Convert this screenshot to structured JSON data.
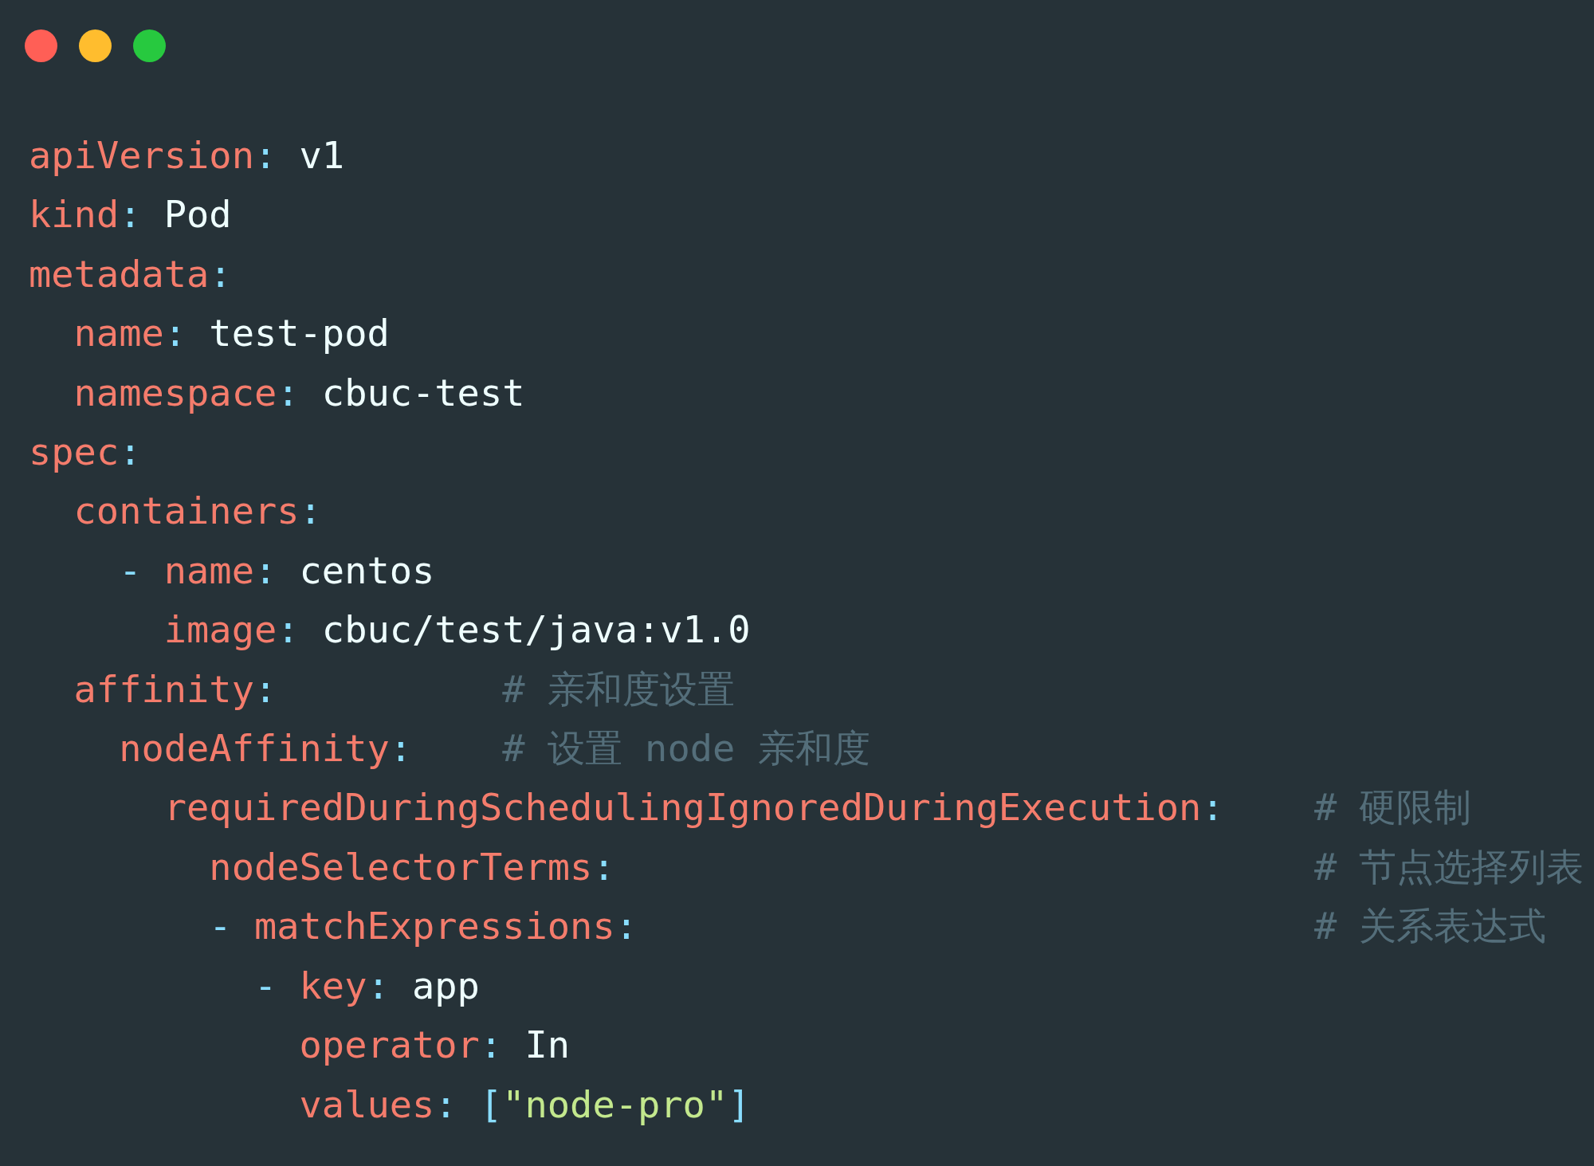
{
  "window": {
    "controls": [
      {
        "kind": "close"
      },
      {
        "kind": "minimize"
      },
      {
        "kind": "maximize"
      }
    ]
  },
  "code": [
    {
      "key": "apiVersion",
      "colon": ":",
      "value": [
        {
          "kind": "plain",
          "text": "v1"
        }
      ]
    },
    {
      "key": "kind",
      "colon": ":",
      "value": [
        {
          "kind": "plain",
          "text": "Pod"
        }
      ]
    },
    {
      "key": "metadata",
      "colon": ":",
      "children": [
        {
          "key": "name",
          "colon": ":",
          "value": [
            {
              "kind": "plain",
              "text": "test-pod"
            }
          ]
        },
        {
          "key": "namespace",
          "colon": ":",
          "value": [
            {
              "kind": "plain",
              "text": "cbuc-test"
            }
          ]
        }
      ]
    },
    {
      "key": "spec",
      "colon": ":",
      "children": [
        {
          "key": "containers",
          "colon": ":",
          "compact_list": false,
          "items": [
            {
              "dash": "-",
              "entries": [
                {
                  "key": "name",
                  "colon": ":",
                  "value": [
                    {
                      "kind": "plain",
                      "text": "centos"
                    }
                  ]
                },
                {
                  "key": "image",
                  "colon": ":",
                  "value": [
                    {
                      "kind": "plain",
                      "text": "cbuc/test/java:v1.0"
                    }
                  ]
                }
              ]
            }
          ]
        },
        {
          "key": "affinity",
          "colon": ":",
          "comment": "# 亲和度设置",
          "children": [
            {
              "key": "nodeAffinity",
              "colon": ":",
              "comment": "# 设置 node 亲和度",
              "children": [
                {
                  "key": "requiredDuringSchedulingIgnoredDuringExecution",
                  "colon": ":",
                  "comment": "# 硬限制",
                  "children": [
                    {
                      "key": "nodeSelectorTerms",
                      "colon": ":",
                      "comment": "# 节点选择列表",
                      "compact_list": true,
                      "items": [
                        {
                          "dash": "-",
                          "entries": [
                            {
                              "key": "matchExpressions",
                              "colon": ":",
                              "comment": "# 关系表达式",
                              "compact_list": true,
                              "items": [
                                {
                                  "dash": "-",
                                  "entries": [
                                    {
                                      "key": "key",
                                      "colon": ":",
                                      "value": [
                                        {
                                          "kind": "plain",
                                          "text": "app"
                                        }
                                      ]
                                    },
                                    {
                                      "key": "operator",
                                      "colon": ":",
                                      "value": [
                                        {
                                          "kind": "plain",
                                          "text": "In"
                                        }
                                      ]
                                    },
                                    {
                                      "key": "values",
                                      "colon": ":",
                                      "value": [
                                        {
                                          "kind": "punct",
                                          "text": "["
                                        },
                                        {
                                          "kind": "string",
                                          "text": "\"node-pro\""
                                        },
                                        {
                                          "kind": "punct",
                                          "text": "]"
                                        }
                                      ]
                                    }
                                  ]
                                }
                              ]
                            }
                          ]
                        }
                      ]
                    }
                  ]
                }
              ]
            }
          ]
        }
      ]
    }
  ]
}
